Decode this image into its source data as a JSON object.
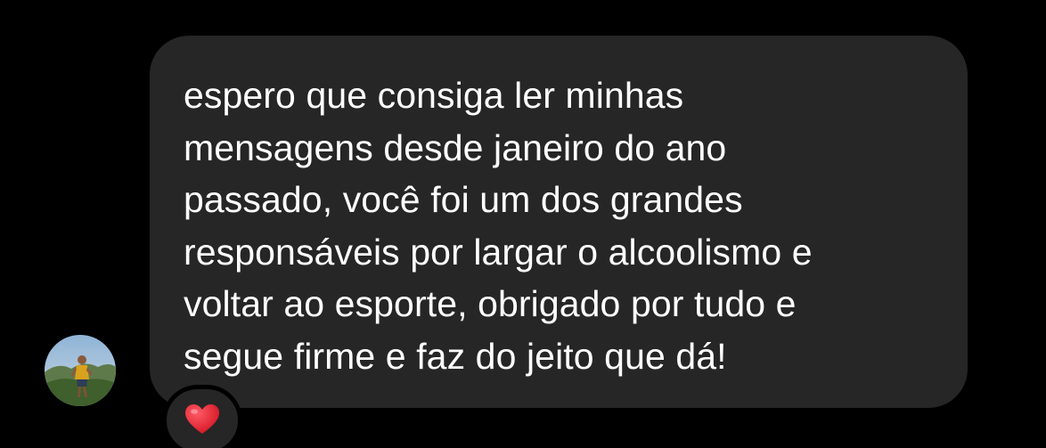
{
  "message": {
    "text": "espero que consiga ler minhas\nmensagens desde janeiro do ano\npassado, você foi um dos grandes\nresponsáveis por largar o alcoolismo e\nvoltar ao esporte, obrigado por tudo e\nsegue firme e faz do jeito que dá!",
    "reaction_icon": "red-heart-icon"
  },
  "sender": {
    "avatar_icon": "profile-photo"
  },
  "colors": {
    "background": "#000000",
    "bubble": "#262626",
    "text": "#ffffff",
    "heart": "#e0192c"
  }
}
